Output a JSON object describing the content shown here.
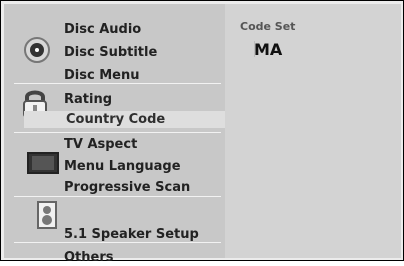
{
  "menu": {
    "items": [
      {
        "label": "Disc Audio"
      },
      {
        "label": "Disc Subtitle"
      },
      {
        "label": "Disc Menu"
      },
      {
        "label": "Rating"
      },
      {
        "label": "Country Code",
        "selected": true
      },
      {
        "label": "TV Aspect"
      },
      {
        "label": "Menu Language"
      },
      {
        "label": "Progressive Scan"
      },
      {
        "label": "5.1 Speaker Setup"
      },
      {
        "label": "Others"
      }
    ],
    "icons": [
      "disc-icon",
      "padlock-icon",
      "tv-icon",
      "speaker-icon"
    ]
  },
  "panel": {
    "title": "Code Set",
    "value": "MA"
  }
}
